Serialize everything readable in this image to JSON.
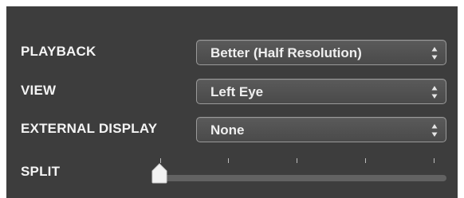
{
  "settings": {
    "playback": {
      "label": "PLAYBACK",
      "value": "Better (Half Resolution)"
    },
    "view": {
      "label": "VIEW",
      "value": "Left Eye"
    },
    "external_display": {
      "label": "EXTERNAL DISPLAY",
      "value": "None"
    },
    "split": {
      "label": "SPLIT",
      "value": 0,
      "tick_count": 5
    }
  },
  "icons": {
    "dropdown": "up-down-arrows-icon"
  },
  "colors": {
    "panel_bg": "#3d3d3d",
    "text": "#f4f4f4",
    "select_border": "#9a9a9a"
  }
}
